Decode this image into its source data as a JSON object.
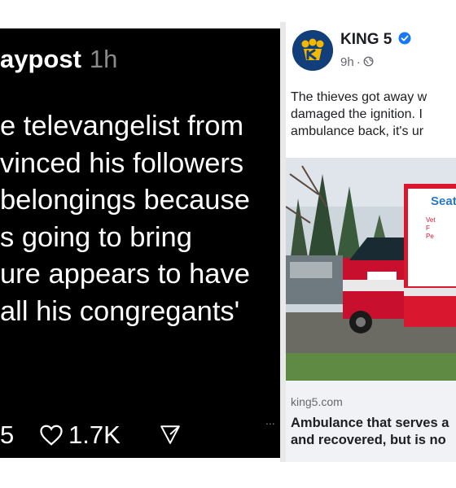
{
  "left_post": {
    "username": "aypost",
    "time": "1h",
    "lines": [
      "e televangelist from",
      "vinced his followers",
      "belongings because",
      "s going to bring",
      "ure appears to have",
      "all his congregants'"
    ],
    "actions": {
      "reply_count": "5",
      "like_count": "1.7K",
      "more_glyph": "..."
    }
  },
  "right_post": {
    "page_name": "KING 5",
    "verified": "verified-badge-icon",
    "time": "9h",
    "audience_icon": "globe-icon",
    "text_lines": [
      "The thieves got away w",
      "damaged the ignition. I",
      "ambulance back, it's ur"
    ],
    "photo": {
      "ambulance_text": "Seatt",
      "side_lines": [
        "Vet",
        "F",
        "Pe"
      ],
      "accent": "#c8102e"
    },
    "link": {
      "domain": "king5.com",
      "title_lines": [
        "Ambulance that serves a",
        "and recovered, but is no"
      ]
    },
    "colors": {
      "brand_blue": "#123f7a",
      "brand_yellow": "#f5b800",
      "verified_blue": "#1877f2"
    }
  }
}
